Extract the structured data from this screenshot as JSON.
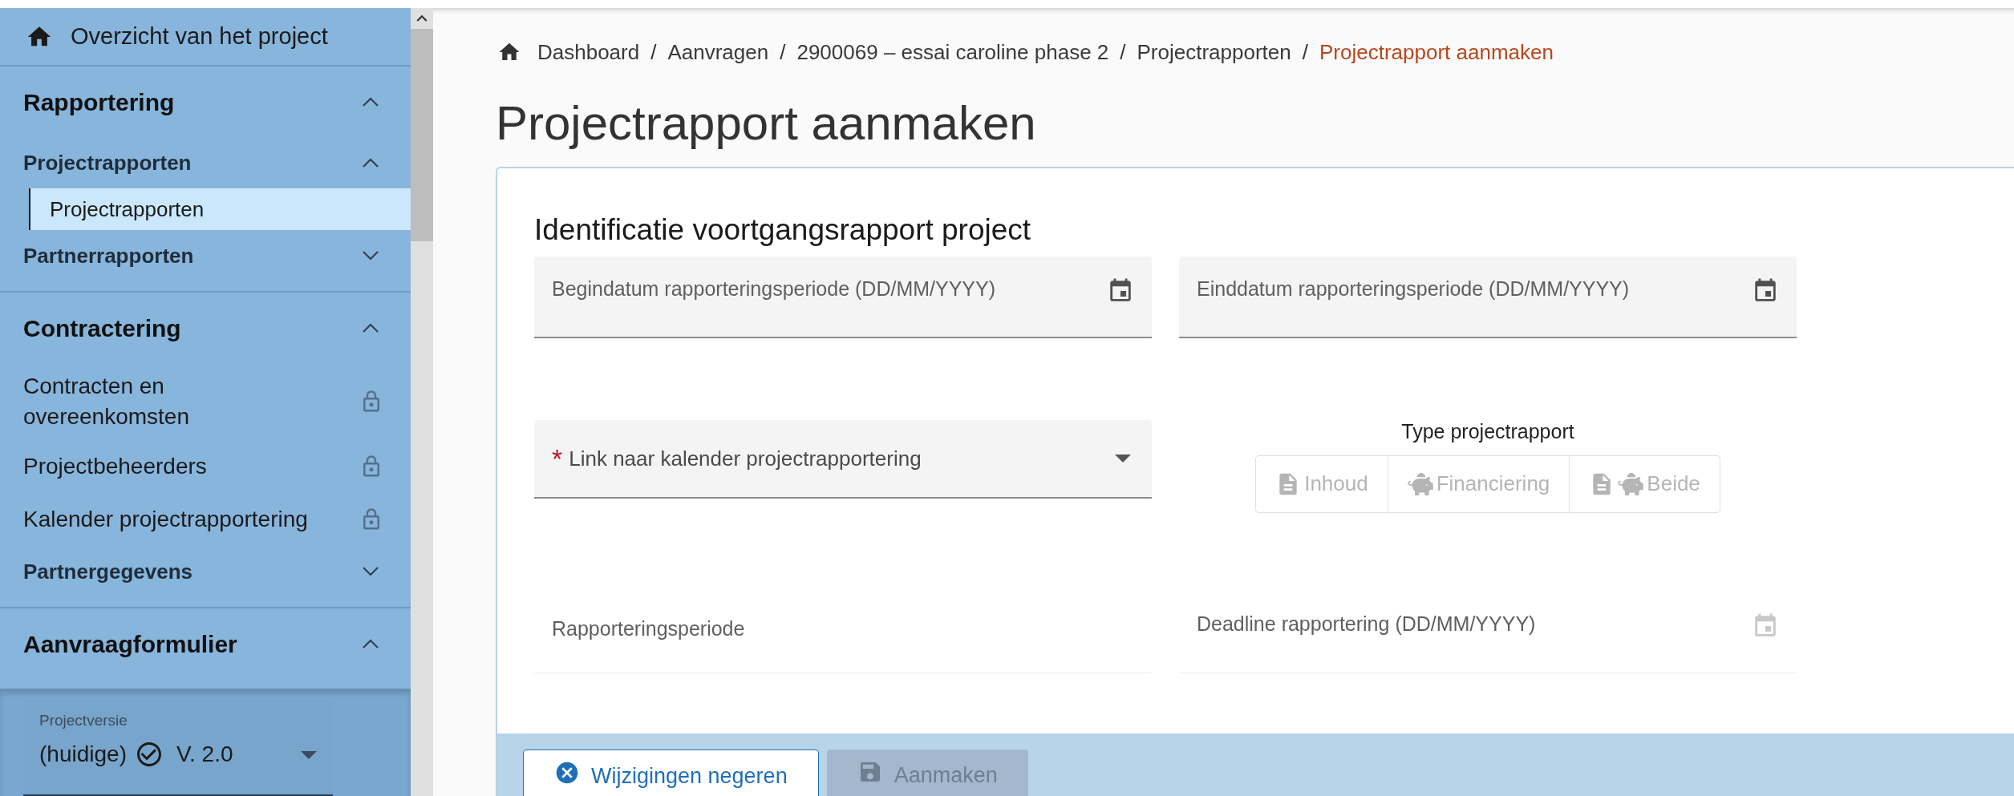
{
  "sidebar": {
    "overview": {
      "label": "Overzicht van het project"
    },
    "sections": [
      {
        "title": "Rapportering",
        "expanded": true,
        "items": [
          {
            "kind": "group",
            "label": "Projectrapporten",
            "expanded": true,
            "children": [
              {
                "label": "Projectrapporten",
                "selected": true
              }
            ]
          },
          {
            "kind": "group",
            "label": "Partnerrapporten",
            "expanded": false
          }
        ]
      },
      {
        "title": "Contractering",
        "expanded": true,
        "items": [
          {
            "kind": "link",
            "label": "Contracten en overeenkomsten",
            "locked": true
          },
          {
            "kind": "link",
            "label": "Projectbeheerders",
            "locked": true
          },
          {
            "kind": "link",
            "label": "Kalender projectrapportering",
            "locked": true
          },
          {
            "kind": "group",
            "label": "Partnergegevens",
            "expanded": false
          }
        ]
      },
      {
        "title": "Aanvraagformulier",
        "expanded": true
      }
    ],
    "version": {
      "label": "Projectversie",
      "prefix": "(huidige)",
      "value": "V. 2.0"
    }
  },
  "breadcrumb": [
    {
      "label": "Dashboard",
      "current": false
    },
    {
      "separator": "/",
      "label": "Aanvragen",
      "current": false
    },
    {
      "separator": "/",
      "label": "2900069 – essai caroline phase 2",
      "current": false
    },
    {
      "separator": "/",
      "label": "Projectrapporten",
      "current": false
    },
    {
      "separator": "/",
      "label": "Projectrapport aanmaken",
      "current": true
    }
  ],
  "title": "Projectrapport aanmaken",
  "form": {
    "heading": "Identificatie voortgangsrapport project",
    "rows": [
      [
        {
          "kind": "date",
          "label": "Begindatum rapporteringsperiode (DD/MM/YYYY)",
          "disabled": false
        },
        {
          "kind": "date",
          "label": "Einddatum rapporteringsperiode (DD/MM/YYYY)",
          "disabled": false
        }
      ],
      [
        {
          "kind": "select",
          "label": "Link naar kalender projectrapportering",
          "required_mark": "*"
        },
        {
          "kind": "segmented",
          "label": "Type projectrapport",
          "options": [
            {
              "label": "Inhoud",
              "kind": "content",
              "disabled": true
            },
            {
              "label": "Financiering",
              "kind": "finance",
              "disabled": true
            },
            {
              "label": "Beide",
              "kind": "both",
              "disabled": true
            }
          ]
        }
      ],
      [
        {
          "kind": "text",
          "label": "Rapporteringsperiode"
        },
        {
          "kind": "date",
          "label": "Deadline rapportering (DD/MM/YYYY)",
          "disabled": true
        }
      ]
    ]
  },
  "buttons": [
    {
      "label": "Wijzigingen negeren",
      "kind": "cancel",
      "disabled": false
    },
    {
      "label": "Aanmaken",
      "kind": "save",
      "disabled": true
    }
  ]
}
